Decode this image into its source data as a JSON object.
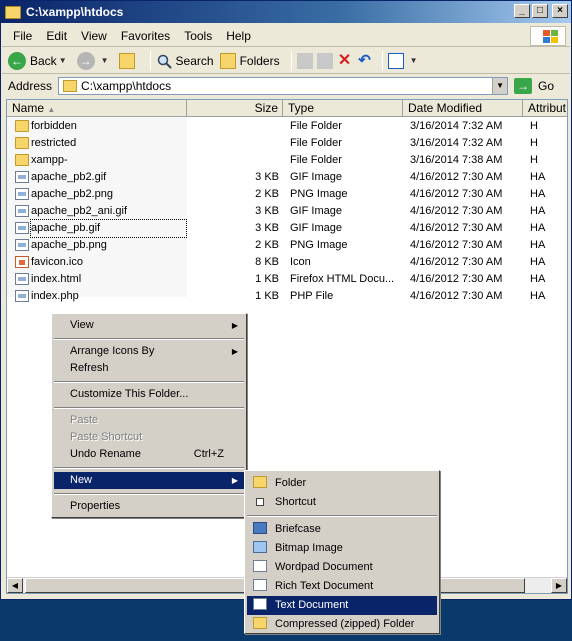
{
  "window": {
    "title": "C:\\xampp\\htdocs"
  },
  "menubar": {
    "items": [
      "File",
      "Edit",
      "View",
      "Favorites",
      "Tools",
      "Help"
    ]
  },
  "toolbar": {
    "back": "Back",
    "search": "Search",
    "folders": "Folders"
  },
  "address": {
    "label": "Address",
    "value": "C:\\xampp\\htdocs",
    "go": "Go"
  },
  "columns": {
    "name": "Name",
    "size": "Size",
    "type": "Type",
    "modified": "Date Modified",
    "attributes": "Attribut"
  },
  "files": [
    {
      "name": "forbidden",
      "size": "",
      "type": "File Folder",
      "modified": "3/16/2014 7:32 AM",
      "attr": "H",
      "icon": "folder"
    },
    {
      "name": "restricted",
      "size": "",
      "type": "File Folder",
      "modified": "3/16/2014 7:32 AM",
      "attr": "H",
      "icon": "folder"
    },
    {
      "name": "xampp-",
      "size": "",
      "type": "File Folder",
      "modified": "3/16/2014 7:38 AM",
      "attr": "H",
      "icon": "folder"
    },
    {
      "name": "apache_pb2.gif",
      "size": "3 KB",
      "type": "GIF Image",
      "modified": "4/16/2012 7:30 AM",
      "attr": "HA",
      "icon": "doc"
    },
    {
      "name": "apache_pb2.png",
      "size": "2 KB",
      "type": "PNG Image",
      "modified": "4/16/2012 7:30 AM",
      "attr": "HA",
      "icon": "doc"
    },
    {
      "name": "apache_pb2_ani.gif",
      "size": "3 KB",
      "type": "GIF Image",
      "modified": "4/16/2012 7:30 AM",
      "attr": "HA",
      "icon": "doc"
    },
    {
      "name": "apache_pb.gif",
      "size": "3 KB",
      "type": "GIF Image",
      "modified": "4/16/2012 7:30 AM",
      "attr": "HA",
      "icon": "doc"
    },
    {
      "name": "apache_pb.png",
      "size": "2 KB",
      "type": "PNG Image",
      "modified": "4/16/2012 7:30 AM",
      "attr": "HA",
      "icon": "doc"
    },
    {
      "name": "favicon.ico",
      "size": "8 KB",
      "type": "Icon",
      "modified": "4/16/2012 7:30 AM",
      "attr": "HA",
      "icon": "red"
    },
    {
      "name": "index.html",
      "size": "1 KB",
      "type": "Firefox HTML Docu...",
      "modified": "4/16/2012 7:30 AM",
      "attr": "HA",
      "icon": "doc"
    },
    {
      "name": "index.php",
      "size": "1 KB",
      "type": "PHP File",
      "modified": "4/16/2012 7:30 AM",
      "attr": "HA",
      "icon": "doc"
    }
  ],
  "context_menu": {
    "view": "View",
    "arrange": "Arrange Icons By",
    "refresh": "Refresh",
    "customize": "Customize This Folder...",
    "paste": "Paste",
    "paste_shortcut": "Paste Shortcut",
    "undo": "Undo Rename",
    "undo_shortcut": "Ctrl+Z",
    "new": "New",
    "properties": "Properties"
  },
  "new_submenu": {
    "folder": "Folder",
    "shortcut": "Shortcut",
    "briefcase": "Briefcase",
    "bitmap": "Bitmap Image",
    "wordpad": "Wordpad Document",
    "rtf": "Rich Text Document",
    "text": "Text Document",
    "zip": "Compressed (zipped) Folder"
  }
}
